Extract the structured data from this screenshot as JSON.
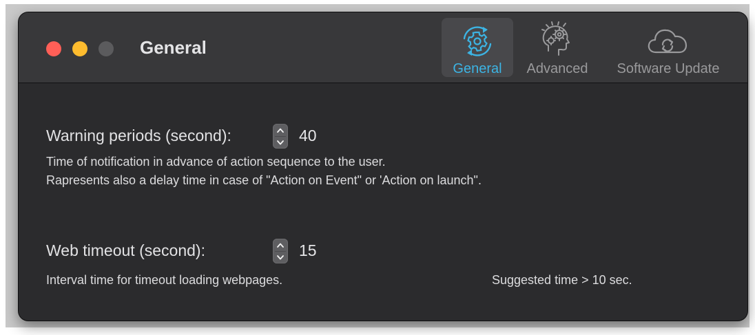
{
  "window": {
    "title": "General"
  },
  "toolbar": {
    "items": [
      {
        "label": "General",
        "icon": "gear-sync-icon",
        "selected": true
      },
      {
        "label": "Advanced",
        "icon": "head-gears-icon",
        "selected": false
      },
      {
        "label": "Software Update",
        "icon": "cloud-sync-icon",
        "selected": false
      }
    ]
  },
  "warning": {
    "label": "Warning periods (second):",
    "value": "40",
    "description_line1": "Time of notification in advance of action sequence to the user.",
    "description_line2": "Rapresents also a delay time in case of \"Action on Event\" or 'Action on launch\"."
  },
  "web_timeout": {
    "label": "Web timeout (second):",
    "value": "15",
    "description": "Interval time for timeout loading webpages.",
    "suggestion": "Suggested time > 10 sec."
  },
  "colors": {
    "window_bg": "#2b2b2d",
    "titlebar_bg": "#38383a",
    "accent": "#3cb4e4",
    "close": "#ff5f57",
    "minimize": "#febc2e",
    "zoom_disabled": "#5b5b5d"
  }
}
